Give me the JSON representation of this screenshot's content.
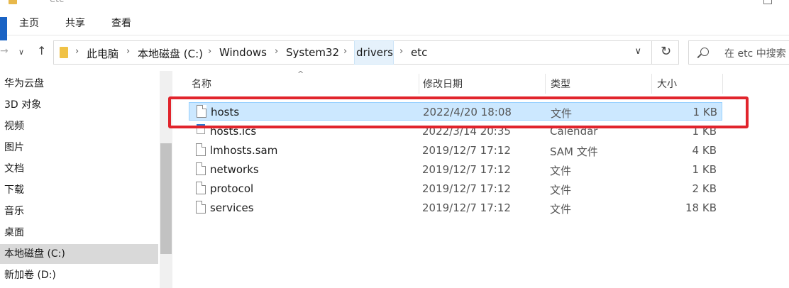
{
  "window": {
    "title": "etc"
  },
  "ribbon": {
    "tabs": [
      "主页",
      "共享",
      "查看"
    ]
  },
  "address": {
    "crumbs": [
      "此电脑",
      "本地磁盘 (C:)",
      "Windows",
      "System32",
      "drivers",
      "etc"
    ],
    "search_placeholder": "在 etc 中搜索"
  },
  "nav_pane": {
    "items": [
      "华为云盘",
      "3D 对象",
      "视频",
      "图片",
      "文档",
      "下载",
      "音乐",
      "桌面",
      "本地磁盘 (C:)",
      "新加卷 (D:)"
    ],
    "selected_index": 8
  },
  "columns": {
    "name": "名称",
    "modified": "修改日期",
    "type": "类型",
    "size": "大小"
  },
  "files": [
    {
      "name": "hosts",
      "modified": "2022/4/20 18:08",
      "type": "文件",
      "size": "1 KB",
      "icon": "file-icon"
    },
    {
      "name": "hosts.ics",
      "modified": "2022/3/14 20:35",
      "type": "Calendar",
      "size": "1 KB",
      "icon": "calendar-file-icon"
    },
    {
      "name": "lmhosts.sam",
      "modified": "2019/12/7 17:12",
      "type": "SAM 文件",
      "size": "4 KB",
      "icon": "file-icon"
    },
    {
      "name": "networks",
      "modified": "2019/12/7 17:12",
      "type": "文件",
      "size": "1 KB",
      "icon": "file-icon"
    },
    {
      "name": "protocol",
      "modified": "2019/12/7 17:12",
      "type": "文件",
      "size": "2 KB",
      "icon": "file-icon"
    },
    {
      "name": "services",
      "modified": "2019/12/7 17:12",
      "type": "文件",
      "size": "18 KB",
      "icon": "file-icon"
    }
  ],
  "colors": {
    "selection": "#cce8ff",
    "highlight_box": "#e1242c",
    "accent": "#1a63c4"
  }
}
